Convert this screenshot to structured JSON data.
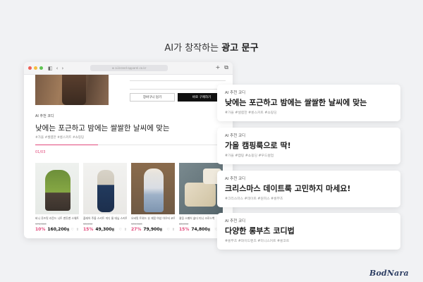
{
  "headline": {
    "prefix": "AI가 창작하는 ",
    "bold": "광고 문구"
  },
  "browser": {
    "url": "⊕ ai.brand-apparel.co.kr",
    "nav_icons": [
      "◧",
      "‹",
      "›"
    ],
    "right_icons": [
      "+",
      "⧉"
    ],
    "dot_colors": [
      "#ee5f57",
      "#f5bd3d",
      "#5fc453"
    ]
  },
  "page": {
    "buttons": {
      "cart": "장바구니 담기",
      "buy": "바로 구매하기"
    },
    "rec_label": "AI 추천 코디",
    "rec_title": "낮에는 포근하고 밤에는 쌀쌀한 날씨에 맞는",
    "rec_tags": "#가을 #셀렙한 #롱스커트 #쇼핑딩",
    "progress_count": "01/03",
    "progress_fraction": 0.33,
    "accent_color": "#e24a7c"
  },
  "products": [
    {
      "name": "비니 루즈핏 라운드 니트 맨투맨 스웨트",
      "original": "170,000",
      "discount": "10%",
      "price": "160,200",
      "unit": "원"
    },
    {
      "name": "플레어 주름 스커트 미디 롱 데님 스커트",
      "original": "58,000",
      "discount": "15%",
      "price": "49,300",
      "unit": "원"
    },
    {
      "name": "오버핏 트위드 숏 재킷 여성 아우터 코트",
      "original": "109,000",
      "discount": "27%",
      "price": "79,900",
      "unit": "원"
    },
    {
      "name": "퀼팅 스퀘어 숄더 미니 크로스백",
      "original": "88,000",
      "discount": "15%",
      "price": "74,800",
      "unit": "원"
    }
  ],
  "product_icons": [
    "♡",
    "⇪"
  ],
  "cards": [
    {
      "label": "AI 추천 코디",
      "title": "낮에는 포근하고 밤에는 쌀쌀한 날씨에 맞는",
      "tags": "#가을 #셀렙한 #롱스커트 #쇼핑딩"
    },
    {
      "label": "AI 추천 코디",
      "title": "가을 캠핑룩으로 딱!",
      "tags": "#가을 #캠핑 #쇼핑딩 #우드컬업"
    },
    {
      "label": "AI 추천 코디",
      "title": "크리스마스 데이트룩 고민하지 마세요!",
      "tags": "#크리스마스 #데이트 #원피스 #롱부츠"
    },
    {
      "label": "AI 추천 코디",
      "title": "다양한 롱부츠 코디법",
      "tags": "#롱부츠 #와이드팬츠 #미니스커트 #롱코트"
    }
  ],
  "logo": "BodNara"
}
